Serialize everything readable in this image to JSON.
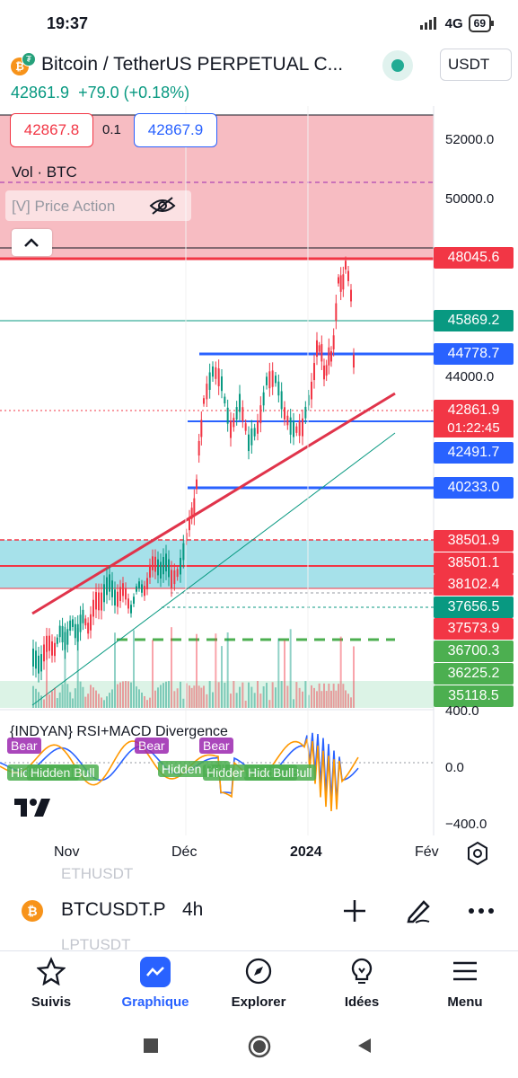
{
  "status_bar": {
    "time": "19:37",
    "network": "4G",
    "battery": "69"
  },
  "header": {
    "title": "Bitcoin / TetherUS PERPETUAL C...",
    "currency": "USDT",
    "price": "42861.9",
    "change": "+79.0 (+0.18%)"
  },
  "order_panel": {
    "bid": "42867.8",
    "spread": "0.1",
    "ask": "42867.9"
  },
  "legend": {
    "volume": "Vol · BTC",
    "indicator": "[V] Price Action"
  },
  "price_axis": {
    "ticks": [
      "52000.0",
      "50000.0",
      "44000.0"
    ],
    "tags": [
      {
        "value": "48045.6",
        "color": "#f23645"
      },
      {
        "value": "45869.2",
        "color": "#089981"
      },
      {
        "value": "44778.7",
        "color": "#2962ff"
      },
      {
        "value": "42861.9",
        "color": "#f23645"
      },
      {
        "value": "42491.7",
        "color": "#2962ff"
      },
      {
        "value": "40233.0",
        "color": "#2962ff"
      },
      {
        "value": "38501.9",
        "color": "#f23645"
      },
      {
        "value": "38501.1",
        "color": "#f23645"
      },
      {
        "value": "38102.4",
        "color": "#f23645"
      },
      {
        "value": "37656.5",
        "color": "#089981"
      },
      {
        "value": "37573.9",
        "color": "#f23645"
      },
      {
        "value": "36700.3",
        "color": "#4caf50"
      },
      {
        "value": "36225.2",
        "color": "#4caf50"
      },
      {
        "value": "35118.5",
        "color": "#4caf50"
      }
    ],
    "countdown": "01:22:45"
  },
  "indicator_pane": {
    "title": "{INDYAN} RSI+MACD Divergence",
    "ticks": [
      "400.0",
      "0.0",
      "−400.0"
    ],
    "bear_labels": [
      "Bear",
      "Bear",
      "Bear"
    ],
    "bull_labels": [
      "Hidden Bull",
      "Hidden Bull",
      "Hidden Bull",
      "Hidden Bull",
      "Hidden Bull",
      "Bull"
    ]
  },
  "time_axis": {
    "labels": [
      "Nov",
      "Déc",
      "2024",
      "Fév"
    ]
  },
  "symbol_bar": {
    "faded_above": "ETHUSDT",
    "faded_below": "LPTUSDT",
    "symbol": "BTCUSDT.P",
    "interval": "4h"
  },
  "bottom_nav": {
    "items": [
      {
        "label": "Suivis",
        "icon": "star-icon",
        "active": false
      },
      {
        "label": "Graphique",
        "icon": "chart-icon",
        "active": true
      },
      {
        "label": "Explorer",
        "icon": "compass-icon",
        "active": false
      },
      {
        "label": "Idées",
        "icon": "lightbulb-icon",
        "active": false
      },
      {
        "label": "Menu",
        "icon": "menu-icon",
        "active": false
      }
    ]
  },
  "colors": {
    "up": "#089981",
    "down": "#f23645",
    "accent": "#2962ff",
    "resistance_zone": "#f7bcc2",
    "support_zone": "#a6e1ea"
  }
}
